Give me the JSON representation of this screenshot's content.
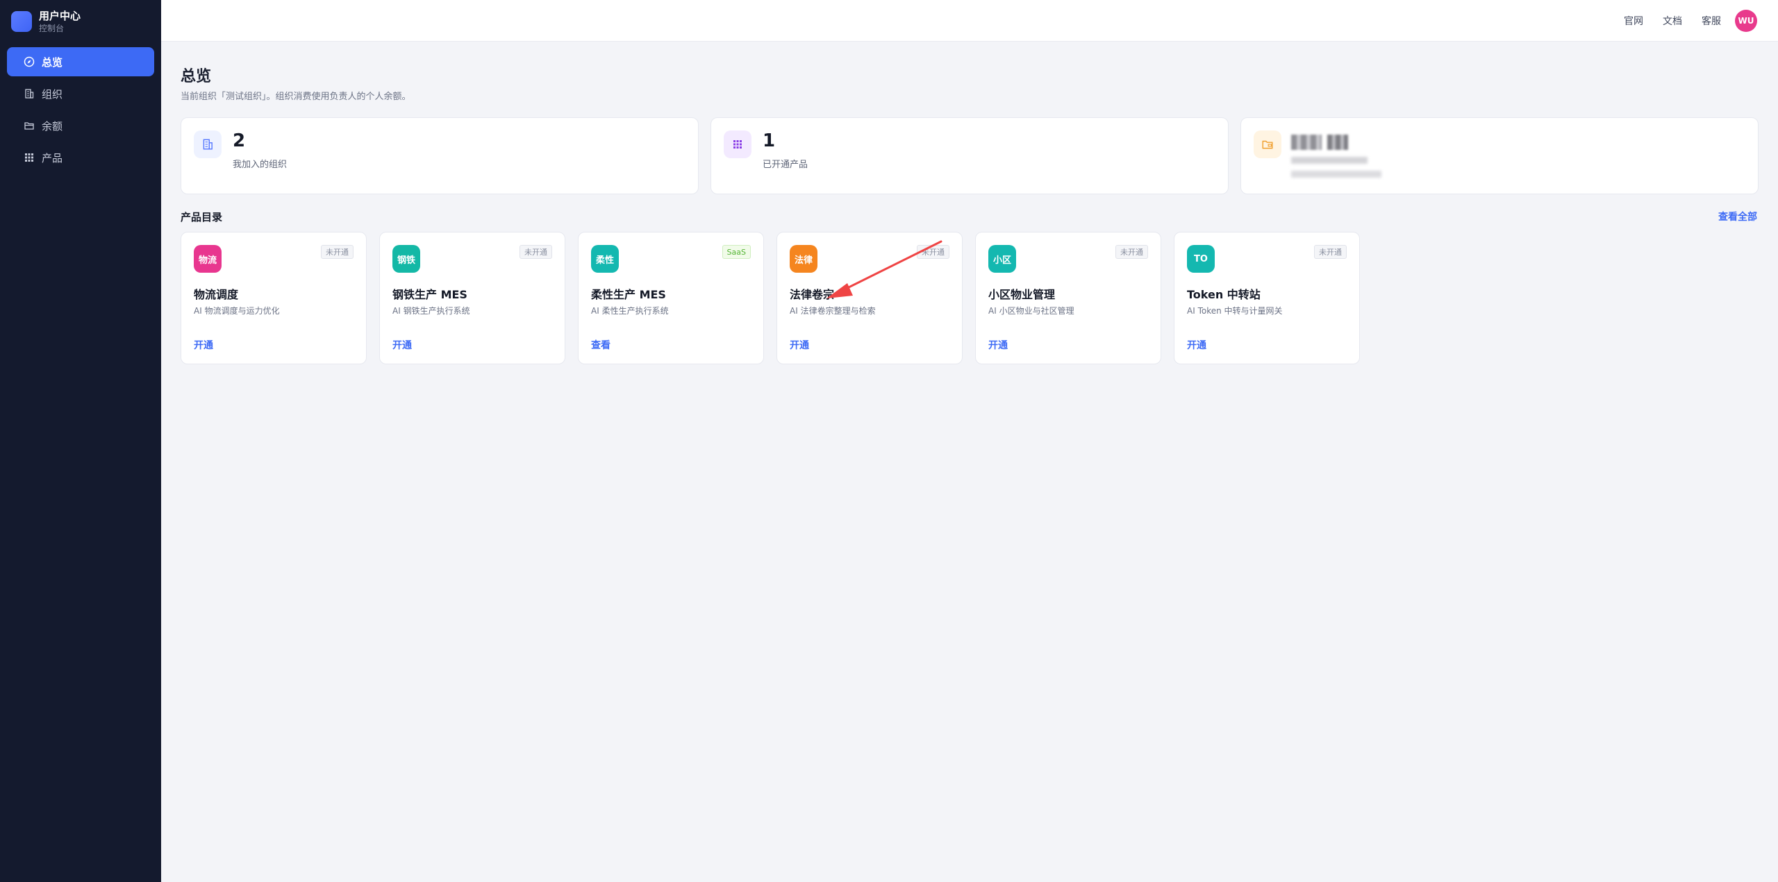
{
  "brand": {
    "title": "用户中心",
    "subtitle": "控制台"
  },
  "sidebar": {
    "items": [
      {
        "label": "总览",
        "icon": "compass-icon",
        "active": true
      },
      {
        "label": "组织",
        "icon": "building-icon",
        "active": false
      },
      {
        "label": "余额",
        "icon": "folder-icon",
        "active": false
      },
      {
        "label": "产品",
        "icon": "grid-icon",
        "active": false
      }
    ]
  },
  "topbar": {
    "links": [
      "官网",
      "文档",
      "客服"
    ],
    "avatar": "WU"
  },
  "page": {
    "title": "总览",
    "subtitle": "当前组织「测试组织」。组织消费使用负责人的个人余额。"
  },
  "stats": [
    {
      "value": "2",
      "label": "我加入的组织",
      "icon": "building-icon",
      "icon_bg": "#eef2ff",
      "icon_color": "#5b7cff"
    },
    {
      "value": "1",
      "label": "已开通产品",
      "icon": "grid-icon",
      "icon_bg": "#f3eaff",
      "icon_color": "#8a3ee6"
    },
    {
      "icon": "wallet-icon",
      "icon_bg": "#fff4e2",
      "icon_color": "#f0a030",
      "blurred": true
    }
  ],
  "catalog": {
    "title": "产品目录",
    "view_all": "查看全部",
    "products": [
      {
        "icon_text": "物流",
        "icon_color": "#e8368f",
        "badge": "未开通",
        "name": "物流调度",
        "desc": "AI 物流调度与运力优化",
        "action": "开通"
      },
      {
        "icon_text": "钢铁",
        "icon_color": "#14b8a6",
        "badge": "未开通",
        "name": "钢铁生产 MES",
        "desc": "AI 钢铁生产执行系统",
        "action": "开通"
      },
      {
        "icon_text": "柔性",
        "icon_color": "#14b8b0",
        "badge": "SaaS",
        "name": "柔性生产 MES",
        "desc": "AI 柔性生产执行系统",
        "action": "查看"
      },
      {
        "icon_text": "法律",
        "icon_color": "#f5851f",
        "badge": "未开通",
        "name": "法律卷宗",
        "desc": "AI 法律卷宗整理与检索",
        "action": "开通"
      },
      {
        "icon_text": "小区",
        "icon_color": "#14b8b0",
        "badge": "未开通",
        "name": "小区物业管理",
        "desc": "AI 小区物业与社区管理",
        "action": "开通"
      },
      {
        "icon_text": "TO",
        "icon_color": "#14b8b0",
        "badge": "未开通",
        "name": "Token 中转站",
        "desc": "AI Token 中转与计量网关",
        "action": "开通"
      }
    ]
  },
  "colors": {
    "accent": "#3d6af5",
    "sidebar": "#141a2e",
    "arrow": "#ef4444"
  }
}
